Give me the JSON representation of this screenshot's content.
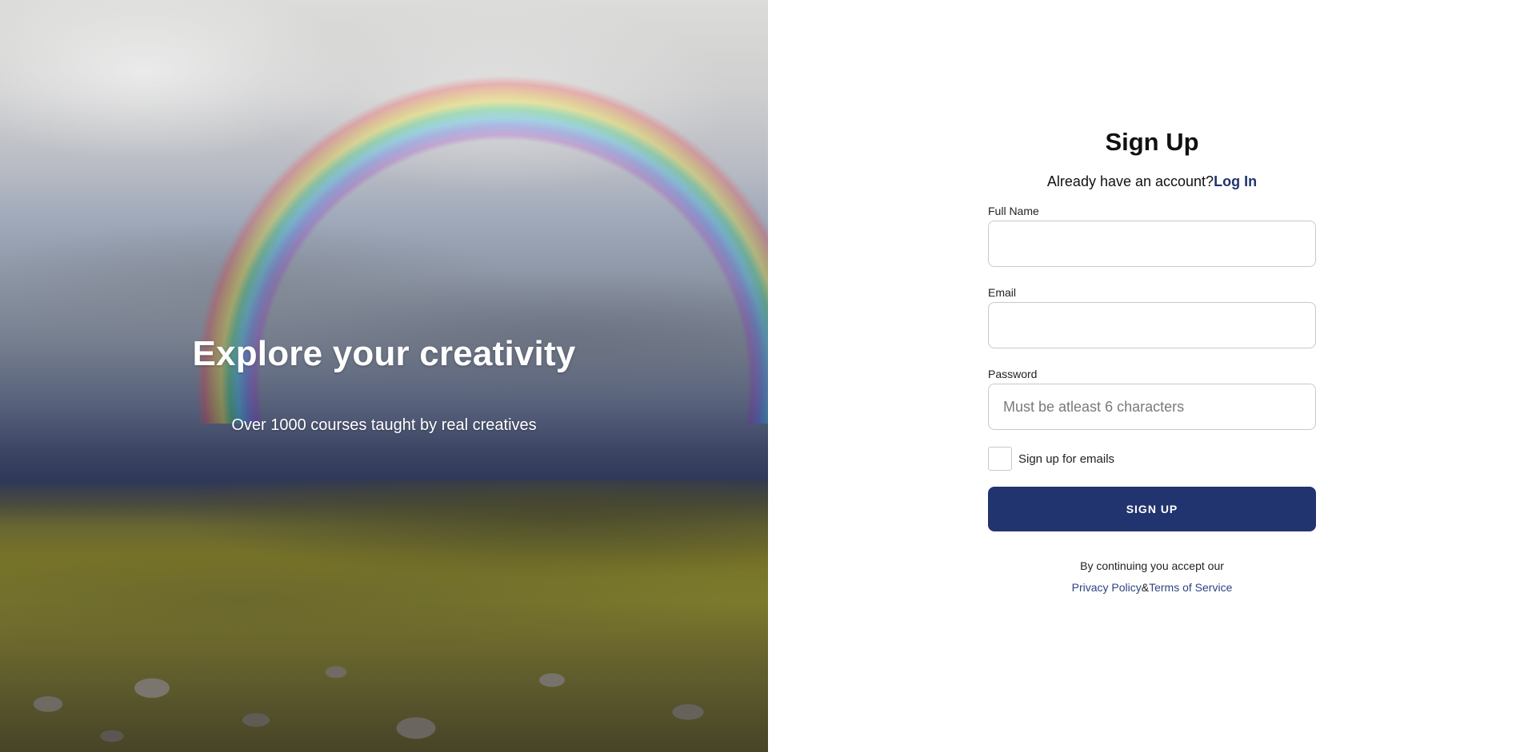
{
  "hero": {
    "title": "Explore your creativity",
    "subtitle": "Over 1000 courses taught by real creatives"
  },
  "form": {
    "title": "Sign Up",
    "login_prompt": "Already have an account?",
    "login_link": "Log In",
    "fields": {
      "full_name": {
        "label": "Full Name",
        "value": "",
        "placeholder": ""
      },
      "email": {
        "label": "Email",
        "value": "",
        "placeholder": ""
      },
      "password": {
        "label": "Password",
        "value": "",
        "placeholder": "Must be atleast 6 characters"
      }
    },
    "email_signup": {
      "label": "Sign up for emails",
      "checked": false
    },
    "submit_label": "SIGN UP",
    "legal": {
      "prefix": "By continuing you accept our",
      "privacy": "Privacy Policy",
      "separator": "&",
      "terms": "Terms of Service"
    }
  },
  "colors": {
    "accent": "#22346f",
    "link": "#2f4480",
    "input_border": "#c9c9c9",
    "background": "#ffffff"
  }
}
